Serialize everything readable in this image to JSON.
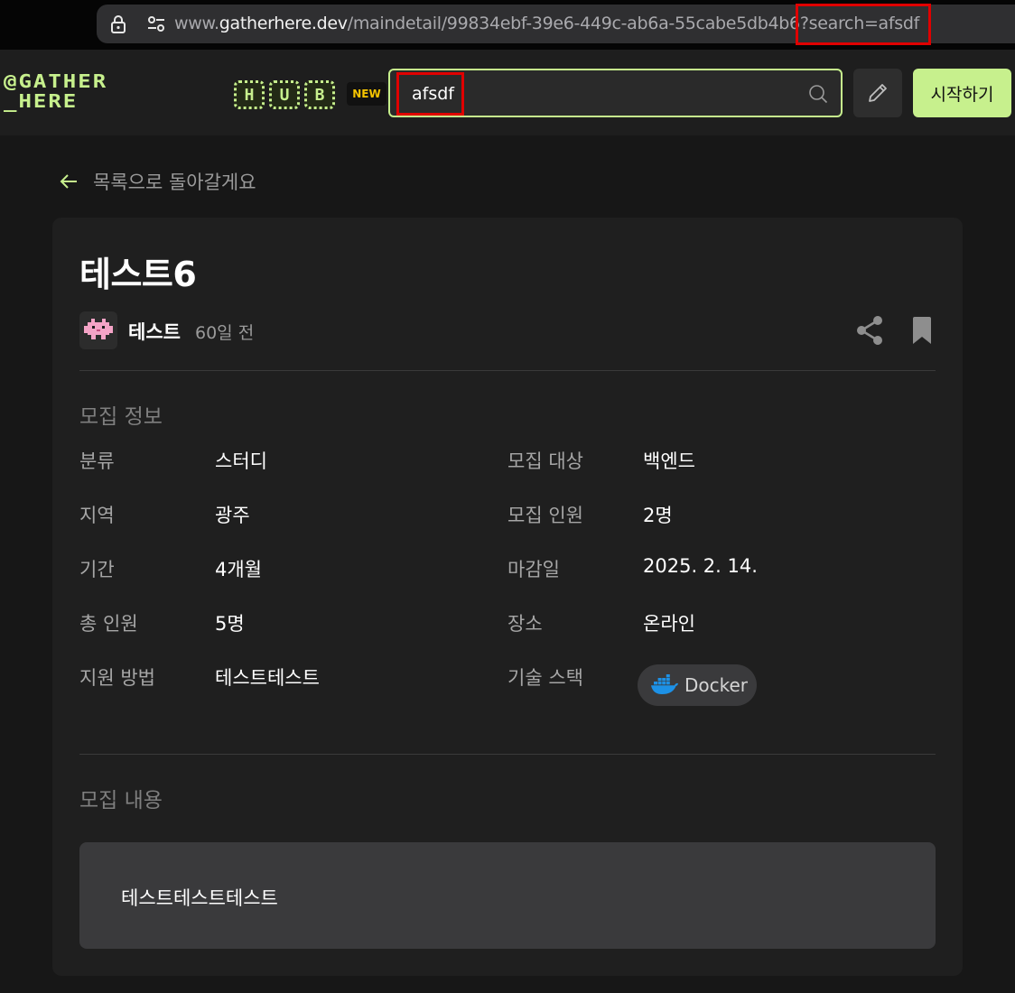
{
  "browser": {
    "url_host_prefix": "www.",
    "url_host": "gatherhere.dev",
    "url_path": "/maindetail/99834ebf-39e6-449c-ab6a-55cabe5db4b6?search=afsdf"
  },
  "header": {
    "logo_line1": "@GATHER",
    "logo_line2": "_HERE",
    "hub_letters": [
      "H",
      "U",
      "B"
    ],
    "new_badge": "NEW",
    "search_value": "afsdf",
    "start_button": "시작하기",
    "accent_color": "#c7f08d"
  },
  "back_link": "목록으로 돌아갈게요",
  "post": {
    "title": "테스트6",
    "author": "테스트",
    "time": "60일 전"
  },
  "recruit_info": {
    "section_title": "모집 정보",
    "left": [
      {
        "label": "분류",
        "value": "스터디"
      },
      {
        "label": "지역",
        "value": "광주"
      },
      {
        "label": "기간",
        "value": "4개월"
      },
      {
        "label": "총 인원",
        "value": "5명"
      },
      {
        "label": "지원 방법",
        "value": "테스트테스트"
      }
    ],
    "right": [
      {
        "label": "모집 대상",
        "value": "백엔드"
      },
      {
        "label": "모집 인원",
        "value": "2명"
      },
      {
        "label": "마감일",
        "value": "2025. 2. 14."
      },
      {
        "label": "장소",
        "value": "온라인"
      },
      {
        "label": "기술 스택",
        "value": ""
      }
    ],
    "tech_stack": [
      "Docker"
    ]
  },
  "content": {
    "section_title": "모집 내용",
    "body": "테스트테스트테스트"
  }
}
